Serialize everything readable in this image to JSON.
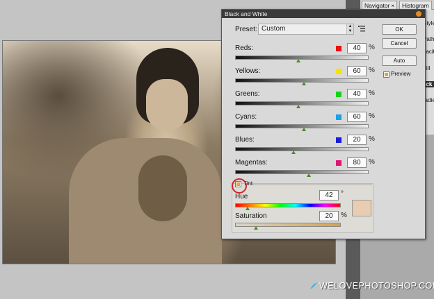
{
  "dialog": {
    "title": "Black and White",
    "preset_label": "Preset:",
    "preset_value": "Custom",
    "buttons": {
      "ok": "OK",
      "cancel": "Cancel",
      "auto": "Auto"
    },
    "preview_label": "Preview",
    "preview_checked": true,
    "sliders": [
      {
        "label": "Reds:",
        "value": "40",
        "unit": "%",
        "color": "#e81010",
        "fraction": 0.48
      },
      {
        "label": "Yellows:",
        "value": "60",
        "unit": "%",
        "color": "#f5e400",
        "fraction": 0.52
      },
      {
        "label": "Greens:",
        "value": "40",
        "unit": "%",
        "color": "#19d21a",
        "fraction": 0.48
      },
      {
        "label": "Cyans:",
        "value": "60",
        "unit": "%",
        "color": "#19a0e8",
        "fraction": 0.52
      },
      {
        "label": "Blues:",
        "value": "20",
        "unit": "%",
        "color": "#1a1ae0",
        "fraction": 0.44
      },
      {
        "label": "Magentas:",
        "value": "80",
        "unit": "%",
        "color": "#e0156f",
        "fraction": 0.56
      }
    ],
    "tint": {
      "label": "Tint",
      "checked": true,
      "hue_label": "Hue",
      "hue_value": "42",
      "hue_unit": "°",
      "hue_fraction": 0.12,
      "saturation_label": "Saturation",
      "saturation_value": "20",
      "saturation_unit": "%",
      "saturation_fraction": 0.2,
      "color": "#e8cdb0"
    }
  },
  "panels": {
    "tabs": [
      {
        "label": "Navigator"
      },
      {
        "label": "Histogram"
      }
    ],
    "side_labels": [
      "Styles",
      "Path",
      "pacity",
      "Fill",
      "ack",
      "radien"
    ]
  },
  "watermark": "WELOVEPHOTOSHOP.COM",
  "colors": {
    "accent": "#e6a53a",
    "highlight_circle": "#d42424"
  }
}
